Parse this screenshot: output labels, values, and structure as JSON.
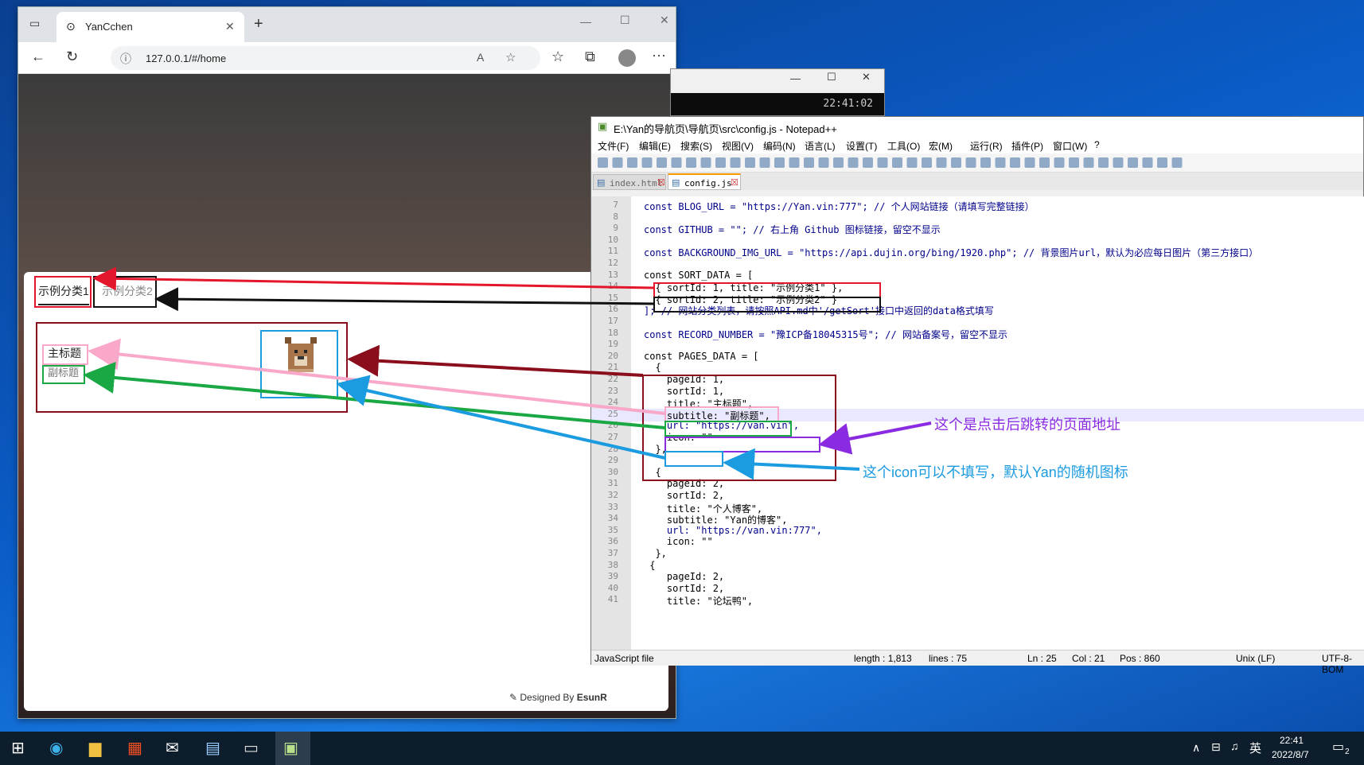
{
  "browser": {
    "tab_title": "YanCchen",
    "url": "127.0.0.1/#/home",
    "read_aloud": "A",
    "more": "···"
  },
  "page": {
    "tabs": [
      "示例分类1",
      "示例分类2"
    ],
    "card": {
      "title": "主标题",
      "subtitle": "副标题"
    },
    "footer_prefix": "Designed By",
    "footer_brand": "EsunR"
  },
  "console": {
    "time": "22:41:02"
  },
  "notepad": {
    "title": "E:\\Yan的导航页\\导航页\\src\\config.js - Notepad++",
    "menu": [
      "文件(F)",
      "编辑(E)",
      "搜索(S)",
      "视图(V)",
      "编码(N)",
      "语言(L)",
      "设置(T)",
      "工具(O)",
      "宏(M)",
      "运行(R)",
      "插件(P)",
      "窗口(W)",
      "?"
    ],
    "tabs": [
      "index.html",
      "config.js"
    ],
    "lines": [
      {
        "n": "7",
        "t": "const BLOG_URL = \"https://Yan.vin:777\"; // 个人网站链接（请填写完整链接）"
      },
      {
        "n": "8",
        "t": ""
      },
      {
        "n": "9",
        "t": "const GITHUB = \"\"; // 右上角 Github 图标链接，留空不显示"
      },
      {
        "n": "10",
        "t": ""
      },
      {
        "n": "11",
        "t": "const BACKGROUND_IMG_URL = \"https://api.dujin.org/bing/1920.php\"; // 背景图片url，默认为必应每日图片（第三方接口）"
      },
      {
        "n": "12",
        "t": ""
      },
      {
        "n": "13",
        "t": "const SORT_DATA = ["
      },
      {
        "n": "14",
        "t": "  { sortId: 1, title: \"示例分类1\" },"
      },
      {
        "n": "15",
        "t": "  { sortId: 2, title: \"示例分类2\" }"
      },
      {
        "n": "16",
        "t": "]; // 网站分类列表，请按照API.md中'/getSort'接口中返回的data格式填写"
      },
      {
        "n": "17",
        "t": ""
      },
      {
        "n": "18",
        "t": "const RECORD_NUMBER = \"豫ICP备18045315号\"; // 网站备案号，留空不显示"
      },
      {
        "n": "19",
        "t": ""
      },
      {
        "n": "20",
        "t": "const PAGES_DATA = ["
      },
      {
        "n": "21",
        "t": "  {"
      },
      {
        "n": "22",
        "t": "    pageId: 1,"
      },
      {
        "n": "23",
        "t": "    sortId: 1,"
      },
      {
        "n": "24",
        "t": "    title: \"主标题\","
      },
      {
        "n": "25",
        "t": "    subtitle: \"副标题\","
      },
      {
        "n": "26",
        "t": "    url: \"https://van.vin\","
      },
      {
        "n": "27",
        "t": "    icon: \"\""
      },
      {
        "n": "28",
        "t": "  },"
      },
      {
        "n": "29",
        "t": ""
      },
      {
        "n": "30",
        "t": "  {"
      },
      {
        "n": "31",
        "t": "    pageId: 2,"
      },
      {
        "n": "32",
        "t": "    sortId: 2,"
      },
      {
        "n": "33",
        "t": "    title: \"个人博客\","
      },
      {
        "n": "34",
        "t": "    subtitle: \"Yan的博客\","
      },
      {
        "n": "35",
        "t": "    url: \"https://van.vin:777\","
      },
      {
        "n": "36",
        "t": "    icon: \"\""
      },
      {
        "n": "37",
        "t": "  },"
      },
      {
        "n": "38",
        "t": " {"
      },
      {
        "n": "39",
        "t": "    pageId: 2,"
      },
      {
        "n": "40",
        "t": "    sortId: 2,"
      },
      {
        "n": "41",
        "t": "    title: \"论坛鸭\","
      }
    ],
    "status": {
      "type": "JavaScript file",
      "length": "length : 1,813",
      "lines": "lines : 75",
      "ln": "Ln : 25",
      "col": "Col : 21",
      "pos": "Pos : 860",
      "eol": "Unix (LF)",
      "enc": "UTF-8-BOM"
    }
  },
  "annotations": {
    "url_note": "这个是点击后跳转的页面地址",
    "icon_note": "这个icon可以不填写，默认Yan的随机图标"
  },
  "taskbar": {
    "ime": "英",
    "time": "22:41",
    "date": "2022/8/7",
    "notif_count": "2"
  },
  "colors": {
    "red": "#e3162b",
    "black": "#111111",
    "darkred": "#8b0e1c",
    "pink": "#f9a8c9",
    "green": "#1aa844",
    "blue": "#1b9be0",
    "purple": "#8a2be2"
  }
}
